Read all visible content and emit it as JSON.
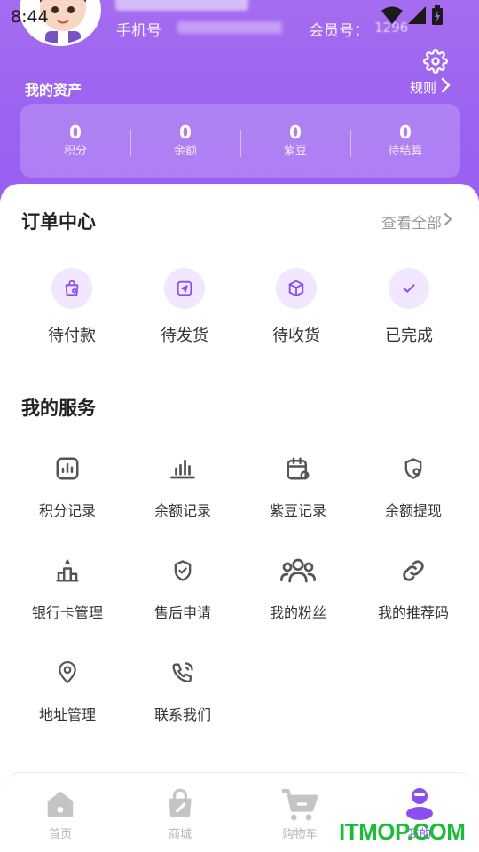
{
  "status_bar": {
    "time": "8:44"
  },
  "profile": {
    "phone_label": "手机号",
    "member_label": "会员号：",
    "member_value": "1296"
  },
  "assets": {
    "title": "我的资产",
    "rules_label": "规则",
    "items": [
      {
        "value": "0",
        "label": "积分"
      },
      {
        "value": "0",
        "label": "余额"
      },
      {
        "value": "0",
        "label": "紫豆"
      },
      {
        "value": "0",
        "label": "待结算"
      }
    ]
  },
  "orders": {
    "title": "订单中心",
    "view_all": "查看全部",
    "items": [
      {
        "label": "待付款",
        "icon": "shopping-bag-icon"
      },
      {
        "label": "待发货",
        "icon": "send-icon"
      },
      {
        "label": "待收货",
        "icon": "package-icon"
      },
      {
        "label": "已完成",
        "icon": "check-icon"
      }
    ]
  },
  "services": {
    "title": "我的服务",
    "items": [
      {
        "label": "积分记录",
        "icon": "bar-chart-box-icon"
      },
      {
        "label": "余额记录",
        "icon": "bar-chart-icon"
      },
      {
        "label": "紫豆记录",
        "icon": "calendar-icon"
      },
      {
        "label": "余额提现",
        "icon": "shield-coin-icon"
      },
      {
        "label": "银行卡管理",
        "icon": "podium-icon"
      },
      {
        "label": "售后申请",
        "icon": "shield-check-icon"
      },
      {
        "label": "我的粉丝",
        "icon": "users-icon"
      },
      {
        "label": "我的推荐码",
        "icon": "link-icon"
      },
      {
        "label": "地址管理",
        "icon": "location-pin-icon"
      },
      {
        "label": "联系我们",
        "icon": "phone-icon"
      }
    ]
  },
  "tabbar": {
    "items": [
      {
        "label": "首页",
        "icon": "home-icon",
        "active": false
      },
      {
        "label": "商城",
        "icon": "shop-bag-icon",
        "active": false
      },
      {
        "label": "购物车",
        "icon": "cart-icon",
        "active": false
      },
      {
        "label": "我的",
        "icon": "profile-icon",
        "active": true
      }
    ]
  },
  "watermark": "ITMOP.COM",
  "colors": {
    "accent": "#9a5ff2",
    "icon_tint_bg": "#f1e7fe",
    "icon_stroke": "#8b4ef0",
    "tab_inactive": "#c4c4c4",
    "watermark": "#1dbb3a"
  }
}
